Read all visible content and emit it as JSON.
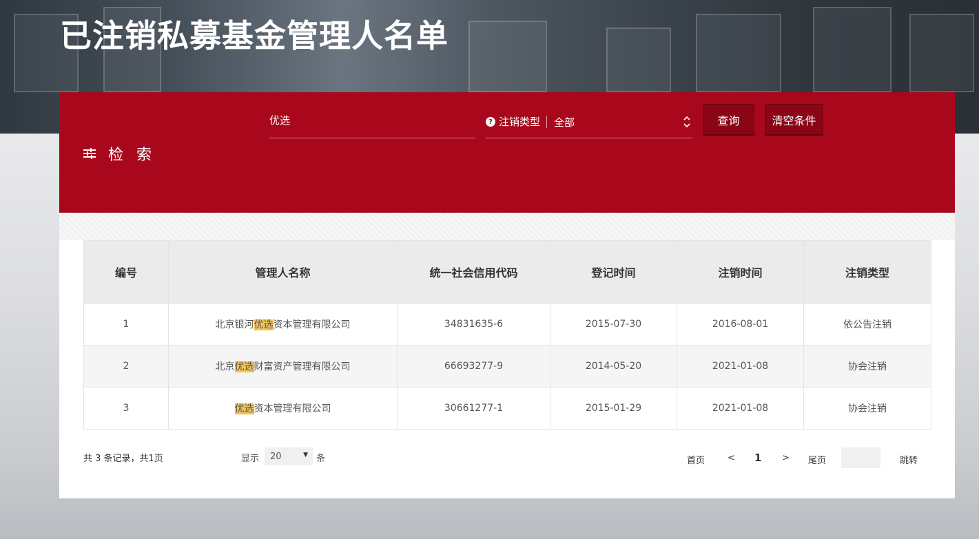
{
  "page": {
    "title": "已注销私募基金管理人名单"
  },
  "search": {
    "section_title": "检 索",
    "keyword_value": "优选",
    "type_label": "注销类型",
    "type_value": "全部",
    "query_label": "查询",
    "clear_label": "清空条件"
  },
  "table": {
    "headers": [
      "编号",
      "管理人名称",
      "统一社会信用代码",
      "登记时间",
      "注销时间",
      "注销类型"
    ],
    "rows": [
      {
        "no": "1",
        "name_pre": "北京银河",
        "name_hl": "优选",
        "name_post": "资本管理有限公司",
        "code": "34831635-6",
        "reg_date": "2015-07-30",
        "cancel_date": "2016-08-01",
        "cancel_type": "依公告注销"
      },
      {
        "no": "2",
        "name_pre": "北京",
        "name_hl": "优选",
        "name_post": "财富资产管理有限公司",
        "code": "66693277-9",
        "reg_date": "2014-05-20",
        "cancel_date": "2021-01-08",
        "cancel_type": "协会注销"
      },
      {
        "no": "3",
        "name_pre": "",
        "name_hl": "优选",
        "name_post": "资本管理有限公司",
        "code": "30661277-1",
        "reg_date": "2015-01-29",
        "cancel_date": "2021-01-08",
        "cancel_type": "协会注销"
      }
    ]
  },
  "pagination": {
    "total_text": "共 3 条记录，共1页",
    "show_label": "显示",
    "page_size": "20",
    "unit_label": "条",
    "first": "首页",
    "prev": "<",
    "current": "1",
    "next": ">",
    "last": "尾页",
    "go": "跳转"
  },
  "colors": {
    "brand_red": "#a9081c",
    "highlight": "#f3c453"
  }
}
